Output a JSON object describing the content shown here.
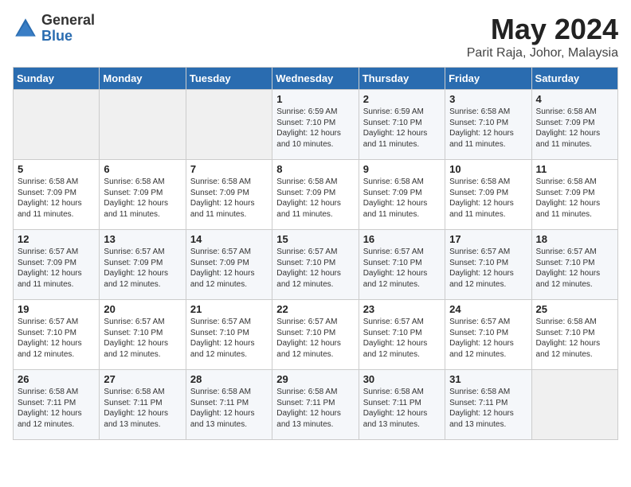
{
  "header": {
    "logo_general": "General",
    "logo_blue": "Blue",
    "month_title": "May 2024",
    "location": "Parit Raja, Johor, Malaysia"
  },
  "weekdays": [
    "Sunday",
    "Monday",
    "Tuesday",
    "Wednesday",
    "Thursday",
    "Friday",
    "Saturday"
  ],
  "weeks": [
    [
      {
        "day": "",
        "info": ""
      },
      {
        "day": "",
        "info": ""
      },
      {
        "day": "",
        "info": ""
      },
      {
        "day": "1",
        "info": "Sunrise: 6:59 AM\nSunset: 7:10 PM\nDaylight: 12 hours\nand 10 minutes."
      },
      {
        "day": "2",
        "info": "Sunrise: 6:59 AM\nSunset: 7:10 PM\nDaylight: 12 hours\nand 11 minutes."
      },
      {
        "day": "3",
        "info": "Sunrise: 6:58 AM\nSunset: 7:10 PM\nDaylight: 12 hours\nand 11 minutes."
      },
      {
        "day": "4",
        "info": "Sunrise: 6:58 AM\nSunset: 7:09 PM\nDaylight: 12 hours\nand 11 minutes."
      }
    ],
    [
      {
        "day": "5",
        "info": "Sunrise: 6:58 AM\nSunset: 7:09 PM\nDaylight: 12 hours\nand 11 minutes."
      },
      {
        "day": "6",
        "info": "Sunrise: 6:58 AM\nSunset: 7:09 PM\nDaylight: 12 hours\nand 11 minutes."
      },
      {
        "day": "7",
        "info": "Sunrise: 6:58 AM\nSunset: 7:09 PM\nDaylight: 12 hours\nand 11 minutes."
      },
      {
        "day": "8",
        "info": "Sunrise: 6:58 AM\nSunset: 7:09 PM\nDaylight: 12 hours\nand 11 minutes."
      },
      {
        "day": "9",
        "info": "Sunrise: 6:58 AM\nSunset: 7:09 PM\nDaylight: 12 hours\nand 11 minutes."
      },
      {
        "day": "10",
        "info": "Sunrise: 6:58 AM\nSunset: 7:09 PM\nDaylight: 12 hours\nand 11 minutes."
      },
      {
        "day": "11",
        "info": "Sunrise: 6:58 AM\nSunset: 7:09 PM\nDaylight: 12 hours\nand 11 minutes."
      }
    ],
    [
      {
        "day": "12",
        "info": "Sunrise: 6:57 AM\nSunset: 7:09 PM\nDaylight: 12 hours\nand 11 minutes."
      },
      {
        "day": "13",
        "info": "Sunrise: 6:57 AM\nSunset: 7:09 PM\nDaylight: 12 hours\nand 12 minutes."
      },
      {
        "day": "14",
        "info": "Sunrise: 6:57 AM\nSunset: 7:09 PM\nDaylight: 12 hours\nand 12 minutes."
      },
      {
        "day": "15",
        "info": "Sunrise: 6:57 AM\nSunset: 7:10 PM\nDaylight: 12 hours\nand 12 minutes."
      },
      {
        "day": "16",
        "info": "Sunrise: 6:57 AM\nSunset: 7:10 PM\nDaylight: 12 hours\nand 12 minutes."
      },
      {
        "day": "17",
        "info": "Sunrise: 6:57 AM\nSunset: 7:10 PM\nDaylight: 12 hours\nand 12 minutes."
      },
      {
        "day": "18",
        "info": "Sunrise: 6:57 AM\nSunset: 7:10 PM\nDaylight: 12 hours\nand 12 minutes."
      }
    ],
    [
      {
        "day": "19",
        "info": "Sunrise: 6:57 AM\nSunset: 7:10 PM\nDaylight: 12 hours\nand 12 minutes."
      },
      {
        "day": "20",
        "info": "Sunrise: 6:57 AM\nSunset: 7:10 PM\nDaylight: 12 hours\nand 12 minutes."
      },
      {
        "day": "21",
        "info": "Sunrise: 6:57 AM\nSunset: 7:10 PM\nDaylight: 12 hours\nand 12 minutes."
      },
      {
        "day": "22",
        "info": "Sunrise: 6:57 AM\nSunset: 7:10 PM\nDaylight: 12 hours\nand 12 minutes."
      },
      {
        "day": "23",
        "info": "Sunrise: 6:57 AM\nSunset: 7:10 PM\nDaylight: 12 hours\nand 12 minutes."
      },
      {
        "day": "24",
        "info": "Sunrise: 6:57 AM\nSunset: 7:10 PM\nDaylight: 12 hours\nand 12 minutes."
      },
      {
        "day": "25",
        "info": "Sunrise: 6:58 AM\nSunset: 7:10 PM\nDaylight: 12 hours\nand 12 minutes."
      }
    ],
    [
      {
        "day": "26",
        "info": "Sunrise: 6:58 AM\nSunset: 7:11 PM\nDaylight: 12 hours\nand 12 minutes."
      },
      {
        "day": "27",
        "info": "Sunrise: 6:58 AM\nSunset: 7:11 PM\nDaylight: 12 hours\nand 13 minutes."
      },
      {
        "day": "28",
        "info": "Sunrise: 6:58 AM\nSunset: 7:11 PM\nDaylight: 12 hours\nand 13 minutes."
      },
      {
        "day": "29",
        "info": "Sunrise: 6:58 AM\nSunset: 7:11 PM\nDaylight: 12 hours\nand 13 minutes."
      },
      {
        "day": "30",
        "info": "Sunrise: 6:58 AM\nSunset: 7:11 PM\nDaylight: 12 hours\nand 13 minutes."
      },
      {
        "day": "31",
        "info": "Sunrise: 6:58 AM\nSunset: 7:11 PM\nDaylight: 12 hours\nand 13 minutes."
      },
      {
        "day": "",
        "info": ""
      }
    ]
  ]
}
